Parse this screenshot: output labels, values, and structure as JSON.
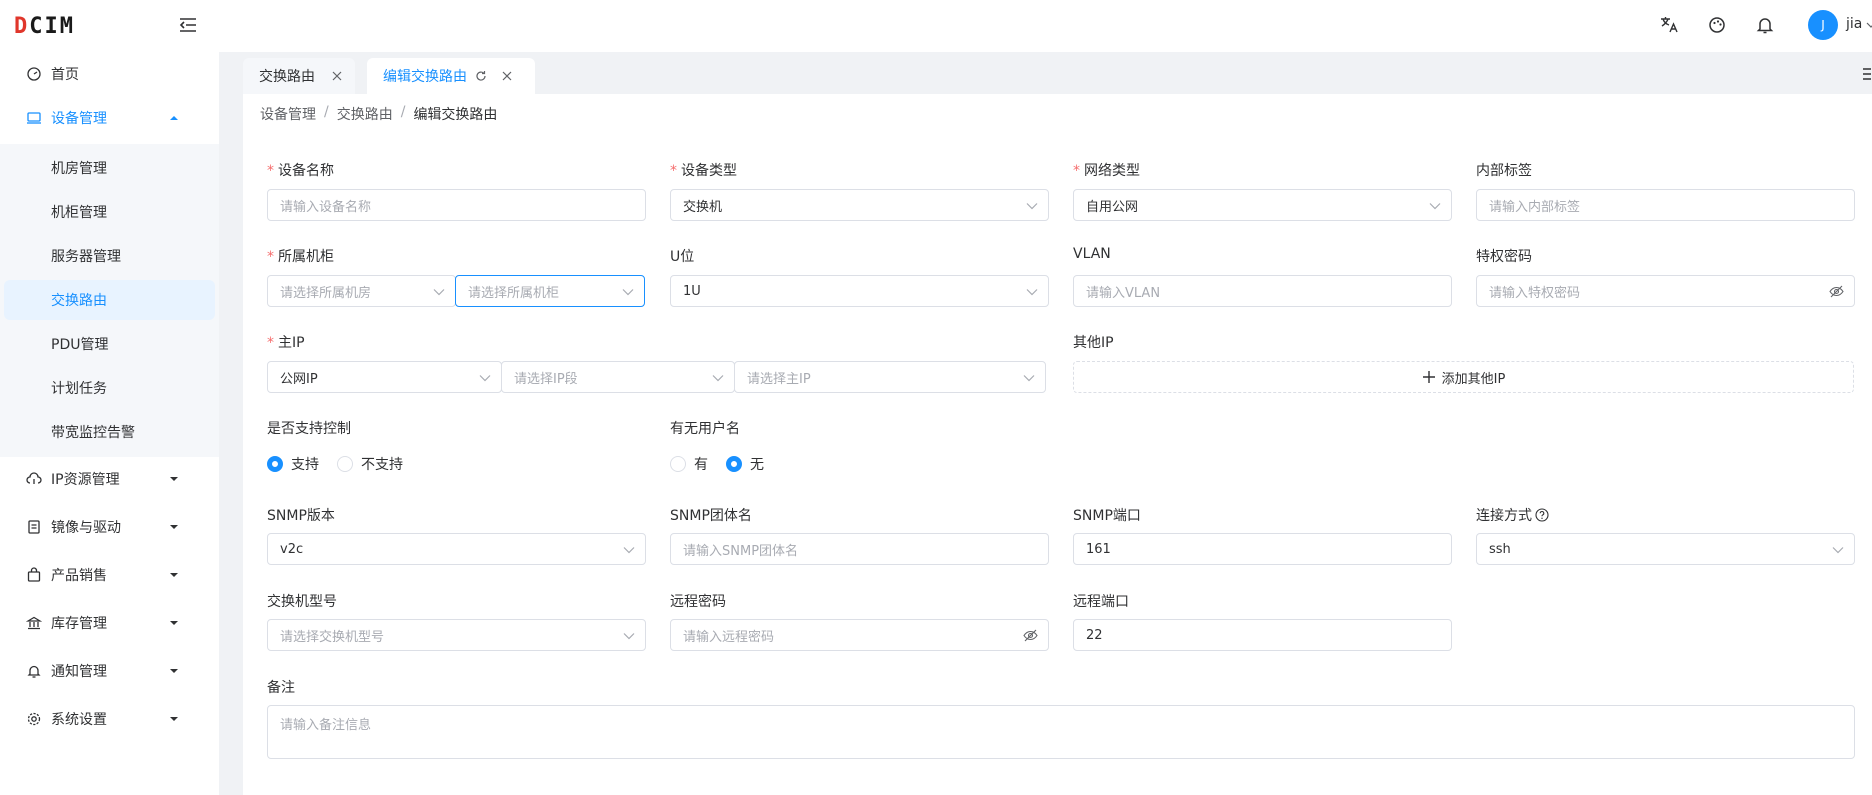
{
  "brand": {
    "logo_prefix": "D",
    "logo_rest": "CIM"
  },
  "header": {
    "user_initial": "J",
    "username": "jia"
  },
  "sidebar": {
    "items": [
      {
        "label": "首页",
        "icon": "dashboard-icon"
      },
      {
        "label": "设备管理",
        "icon": "monitor-icon"
      },
      {
        "label": "IP资源管理",
        "icon": "cloud-icon"
      },
      {
        "label": "镜像与驱动",
        "icon": "file-icon"
      },
      {
        "label": "产品销售",
        "icon": "bag-icon"
      },
      {
        "label": "库存管理",
        "icon": "bank-icon"
      },
      {
        "label": "通知管理",
        "icon": "bell-icon"
      },
      {
        "label": "系统设置",
        "icon": "gear-icon"
      }
    ],
    "sub_items": [
      "机房管理",
      "机柜管理",
      "服务器管理",
      "交换路由",
      "PDU管理",
      "计划任务",
      "带宽监控告警"
    ]
  },
  "tabs": [
    {
      "label": "交换路由"
    },
    {
      "label": "编辑交换路由"
    }
  ],
  "breadcrumb": [
    "设备管理",
    "交换路由",
    "编辑交换路由"
  ],
  "form": {
    "device_name": {
      "label": "设备名称",
      "placeholder": "请输入设备名称"
    },
    "device_type": {
      "label": "设备类型",
      "value": "交换机"
    },
    "network_type": {
      "label": "网络类型",
      "value": "自用公网"
    },
    "internal_tag": {
      "label": "内部标签",
      "placeholder": "请输入内部标签"
    },
    "cabinet": {
      "label": "所属机柜",
      "room_placeholder": "请选择所属机房",
      "cabinet_placeholder": "请选择所属机柜"
    },
    "u_position": {
      "label": "U位",
      "value": "1U"
    },
    "vlan": {
      "label": "VLAN",
      "placeholder": "请输入VLAN"
    },
    "privilege_password": {
      "label": "特权密码",
      "placeholder": "请输入特权密码"
    },
    "main_ip": {
      "label": "主IP",
      "type_value": "公网IP",
      "segment_placeholder": "请选择IP段",
      "ip_placeholder": "请选择主IP"
    },
    "other_ip": {
      "label": "其他IP",
      "add_label": "添加其他IP"
    },
    "control_support": {
      "label": "是否支持控制",
      "options": [
        "支持",
        "不支持"
      ],
      "selected": "支持"
    },
    "has_username": {
      "label": "有无用户名",
      "options": [
        "有",
        "无"
      ],
      "selected": "无"
    },
    "snmp_version": {
      "label": "SNMP版本",
      "value": "v2c"
    },
    "snmp_community": {
      "label": "SNMP团体名",
      "placeholder": "请输入SNMP团体名"
    },
    "snmp_port": {
      "label": "SNMP端口",
      "value": "161"
    },
    "connection": {
      "label": "连接方式",
      "value": "ssh"
    },
    "switch_model": {
      "label": "交换机型号",
      "placeholder": "请选择交换机型号"
    },
    "remote_password": {
      "label": "远程密码",
      "placeholder": "请输入远程密码"
    },
    "remote_port": {
      "label": "远程端口",
      "value": "22"
    },
    "remark": {
      "label": "备注",
      "placeholder": "请输入备注信息"
    }
  },
  "colors": {
    "primary": "#1890ff",
    "required": "#f56c6c",
    "brand_red": "#e0362b"
  }
}
